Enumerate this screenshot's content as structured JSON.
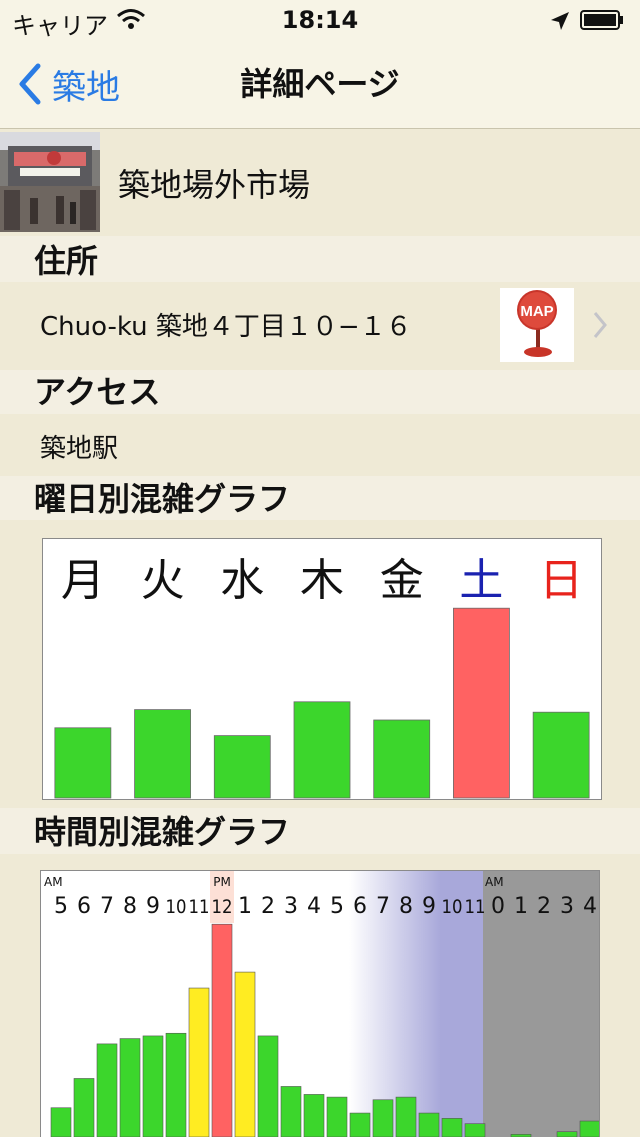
{
  "status_bar": {
    "carrier": "キャリア",
    "time": "18:14"
  },
  "nav": {
    "back_label": "築地",
    "title": "詳細ページ"
  },
  "place": {
    "name": "築地場外市場"
  },
  "sections": {
    "address_header": "住所",
    "access_header": "アクセス",
    "weekday_header": "曜日別混雑グラフ",
    "hourly_header": "時間別混雑グラフ"
  },
  "address": {
    "text": "Chuo-ku 築地４丁目１０−１６",
    "map_label": "MAP"
  },
  "access": {
    "text": "築地駅"
  },
  "colors": {
    "accent": "#2a7be4",
    "bar_green": "#3cd62c",
    "bar_red": "#ff6262",
    "bar_yellow": "#ffec22",
    "saturday": "#1a22b0",
    "sunday": "#e8231c",
    "night_band": "#a8a8da",
    "late_night": "#999999"
  },
  "chart_data": [
    {
      "type": "bar",
      "categories": [
        "月",
        "火",
        "水",
        "木",
        "金",
        "土",
        "日"
      ],
      "values": [
        27,
        34,
        24,
        37,
        30,
        73,
        33
      ],
      "highlight": {
        "土": "red"
      },
      "label_colors": {
        "土": "blue",
        "日": "red"
      },
      "ylim": [
        0,
        100
      ],
      "title": "",
      "xlabel": "",
      "ylabel": ""
    },
    {
      "type": "bar",
      "period_labels": {
        "AM": "AM",
        "PM": "PM",
        "AM2": "AM"
      },
      "categories": [
        "5",
        "6",
        "7",
        "8",
        "9",
        "10",
        "11",
        "12",
        "1",
        "2",
        "3",
        "4",
        "5",
        "6",
        "7",
        "8",
        "9",
        "10",
        "11",
        "0",
        "1",
        "2",
        "3",
        "4"
      ],
      "values": [
        11,
        22,
        35,
        37,
        38,
        39,
        56,
        80,
        62,
        38,
        19,
        16,
        15,
        9,
        14,
        15,
        9,
        7,
        5,
        0,
        1,
        0,
        2,
        6
      ],
      "bar_colors": [
        "green",
        "green",
        "green",
        "green",
        "green",
        "green",
        "yellow",
        "red",
        "yellow",
        "green",
        "green",
        "green",
        "green",
        "green",
        "green",
        "green",
        "green",
        "green",
        "green",
        "green",
        "green",
        "green",
        "green",
        "green"
      ],
      "ylim": [
        0,
        100
      ],
      "title": "",
      "xlabel": "",
      "ylabel": ""
    }
  ]
}
